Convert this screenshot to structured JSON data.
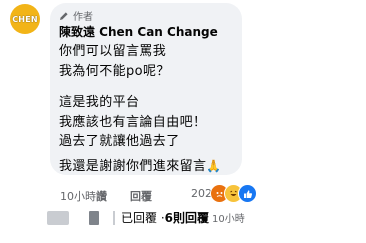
{
  "avatar": {
    "text": "CHEN",
    "color": "#f2b417"
  },
  "comment": {
    "badge": "作者",
    "badge_icon": "pencil-icon",
    "author": "陳致遠 Chen Can Change",
    "lines": [
      "你們可以留言罵我",
      "我為何不能po呢？",
      "這是我的平台",
      "我應該也有言論自由吧！",
      "過去了就讓他過去了",
      "我還是謝謝你們進來留言"
    ],
    "end_emoji": "🙏"
  },
  "actions": {
    "time": "10小時",
    "like": "讚",
    "reply": "回覆",
    "reaction_count": "202",
    "reaction_icons": [
      "angry-icon",
      "haha-icon",
      "like-icon"
    ]
  },
  "replies": {
    "seen_label": "已回覆 · ",
    "count_label": "6則回覆",
    "time": "10小時"
  }
}
